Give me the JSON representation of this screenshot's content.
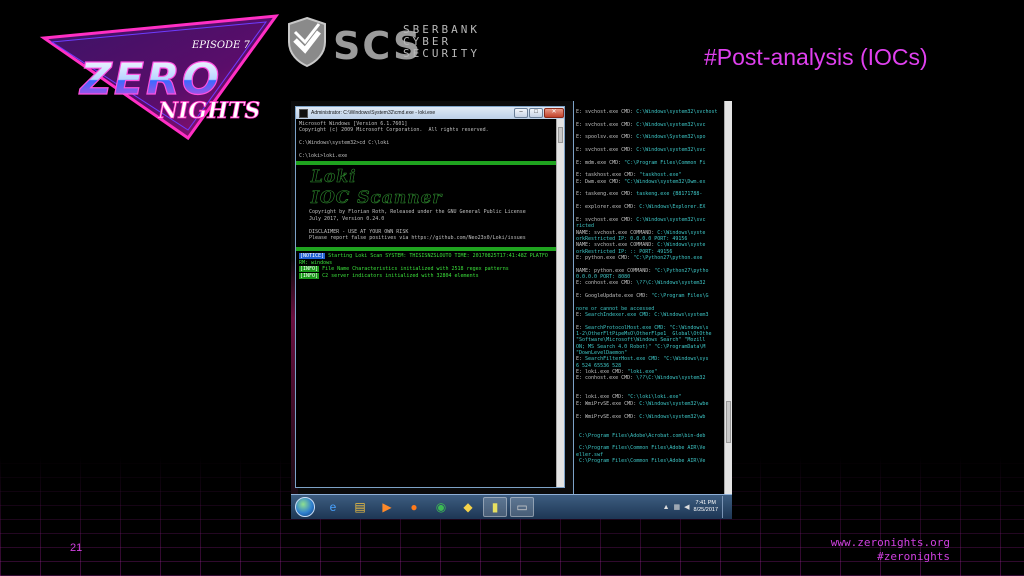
{
  "slide": {
    "title": "#Post-analysis (IOCs)",
    "page_number": "21",
    "website": "www.zeronights.org",
    "hashtag": "#zeronights",
    "accent_color": "#e040ef"
  },
  "logos": {
    "zeronights": {
      "episode": "EPISODE 7",
      "word1": "ZERO",
      "word2": "NIGHTS"
    },
    "scs": {
      "letters": "SCS",
      "line1": "SBERBANK",
      "line2": "CYBER",
      "line3": "SECURITY"
    }
  },
  "cmd1": {
    "title": "Administrator: C:\\Windows\\System32\\cmd.exe - loki.exe",
    "buttons": {
      "minimize": "–",
      "maximize": "□",
      "close": "✕"
    },
    "lines": {
      "l1": "Microsoft Windows [Version 6.1.7601]",
      "l2": "Copyright (c) 2009 Microsoft Corporation.  All rights reserved.",
      "l3": "C:\\Windows\\system32>cd C:\\loki",
      "l4": "C:\\loki>loki.exe",
      "big1": "Loki",
      "big2": "IOC Scanner",
      "l5": "Copyright by Florian Roth, Released under the GNU General Public License",
      "l6": "July 2017, Version 0.24.0",
      "l7": "DISCLAIMER - USE AT YOUR OWN RISK",
      "l8": "Please report false positives via https://github.com/Neo23x0/Loki/issues",
      "notice_label": "[NOTICE]",
      "notice_text": " Starting Loki Scan SYSTEM: THISISNZSLOUTO TIME: 20170825T17:41:48Z PLATFO",
      "notice_cont": "RM: windows",
      "info1_label": "[INFO]",
      "info1_text": " File Name Characteristics initialized with 2518 regex patterns",
      "info2_label": "[INFO]",
      "info2_text": " C2 server indicators initialized with 32804 elements"
    }
  },
  "cmd2": {
    "lines": [
      {
        "k": "E: svchost.exe CMD: ",
        "v": "C:\\Windows\\system32\\svchost"
      },
      {
        "k": "",
        "v": ""
      },
      {
        "k": "E: svchost.exe CMD: ",
        "v": "C:\\Windows\\system32\\svc"
      },
      {
        "k": "",
        "v": ""
      },
      {
        "k": "E: spoolsv.exe CMD: ",
        "v": "C:\\Windows\\System32\\spo"
      },
      {
        "k": "",
        "v": ""
      },
      {
        "k": "E: svchost.exe CMD: ",
        "v": "C:\\Windows\\system32\\svc"
      },
      {
        "k": "",
        "v": ""
      },
      {
        "k": "E: mdm.exe CMD: ",
        "v": "\"C:\\Program Files\\Common Fi"
      },
      {
        "k": "",
        "v": ""
      },
      {
        "k": "E: taskhost.exe CMD: ",
        "v": "\"taskhost.exe\""
      },
      {
        "k": "E: Dwm.exe CMD: ",
        "v": "\"C:\\Windows\\system32\\Dwm.ex"
      },
      {
        "k": "",
        "v": ""
      },
      {
        "k": "E: taskeng.exe CMD: ",
        "v": "taskeng.exe {B8171788-"
      },
      {
        "k": "",
        "v": ""
      },
      {
        "k": "E: explorer.exe CMD: ",
        "v": "C:\\Windows\\Explorer.EX"
      },
      {
        "k": "",
        "v": ""
      },
      {
        "k": "E: svchost.exe CMD: ",
        "v": "C:\\Windows\\system32\\svc"
      },
      {
        "k": "",
        "v": "ricted"
      },
      {
        "k": "NAME: svchost.exe COMMAND: ",
        "v": "C:\\Windows\\syste"
      },
      {
        "k": "",
        "v": "orkRestricted IP: 0.0.0.0 PORT: 49156"
      },
      {
        "k": "NAME: svchost.exe COMMAND: ",
        "v": "C:\\Windows\\syste"
      },
      {
        "k": "",
        "v": "orkRestricted IP: :: PORT: 49156"
      },
      {
        "k": "E: python.exe CMD: ",
        "v": "\"C:\\Python27\\python.exe"
      },
      {
        "k": "",
        "v": ""
      },
      {
        "k": "NAME: python.exe COMMAND: ",
        "v": "\"C:\\Python27\\pytho"
      },
      {
        "k": "",
        "v": "0.0.0.0 PORT: 8080"
      },
      {
        "k": "E: conhost.exe CMD: ",
        "v": "\\??\\C:\\Windows\\system32"
      },
      {
        "k": "",
        "v": ""
      },
      {
        "k": "E: GoogleUpdate.exe CMD: ",
        "v": "\"C:\\Program Files\\G"
      },
      {
        "k": "",
        "v": ""
      },
      {
        "k": "",
        "v": "nore or cannot be accessed"
      },
      {
        "k": "E: ",
        "v": "SearchIndexer.exe CMD: C:\\Windows\\system3"
      },
      {
        "k": "",
        "v": ""
      },
      {
        "k": "E: ",
        "v": "SearchProtocolHost.exe CMD: \"C:\\Windows\\s"
      },
      {
        "k": "",
        "v": "1-2\\OtherFltPipeMsO\\OtherFlpe1_ Global\\OtOthe"
      },
      {
        "k": "",
        "v": "\"Software\\Microsoft\\Windows Search\" \"Mozill"
      },
      {
        "k": "",
        "v": "ON; MS Search 4.0 Robot)\" \"C:\\ProgramData\\M"
      },
      {
        "k": "",
        "v": "\"DownLevelDaemon\""
      },
      {
        "k": "E: ",
        "v": "SearchFilterHost.exe CMD: \"C:\\Windows\\sys"
      },
      {
        "k": "",
        "v": "6 524 65536 528"
      },
      {
        "k": "E: loki.exe CMD: ",
        "v": "\"loki.exe\""
      },
      {
        "k": "E: conhost.exe CMD: ",
        "v": "\\??\\C:\\Windows\\system32"
      },
      {
        "k": "",
        "v": ""
      },
      {
        "k": "",
        "v": ""
      },
      {
        "k": "E: loki.exe CMD: ",
        "v": "\"C:\\loki\\loki.exe\""
      },
      {
        "k": "E: WmiPrvSE.exe CMD: ",
        "v": "C:\\Windows\\system32\\wbe"
      },
      {
        "k": "",
        "v": ""
      },
      {
        "k": "E: WmiPrvSE.exe CMD: ",
        "v": "C:\\Windows\\system32\\wb"
      },
      {
        "k": "",
        "v": ""
      },
      {
        "k": "",
        "v": ""
      },
      {
        "k": "",
        "v": " C:\\Program Files\\Adobe\\Acrobat.com\\bin-deb"
      },
      {
        "k": "",
        "v": ""
      },
      {
        "k": "",
        "v": " C:\\Program Files\\Common Files\\Adobe AIR\\Ve"
      },
      {
        "k": "",
        "v": "eller.swf"
      },
      {
        "k": "",
        "v": " C:\\Program Files\\Common Files\\Adobe AIR\\Ve"
      }
    ]
  },
  "taskbar": {
    "items": [
      {
        "name": "internet-explorer-icon",
        "glyph": "e",
        "color": "#4aa3ff"
      },
      {
        "name": "windows-explorer-icon",
        "glyph": "▤",
        "color": "#f0c040"
      },
      {
        "name": "media-player-icon",
        "glyph": "▶",
        "color": "#ff8a2a"
      },
      {
        "name": "firefox-icon",
        "glyph": "●",
        "color": "#ff7a1a"
      },
      {
        "name": "chrome-icon",
        "glyph": "◉",
        "color": "#3cba54"
      },
      {
        "name": "python-icon",
        "glyph": "◆",
        "color": "#f5d34a"
      },
      {
        "name": "notepad-icon",
        "glyph": "▮",
        "color": "#e8e060"
      },
      {
        "name": "cmd-icon",
        "glyph": "▭",
        "color": "#cfcfcf"
      }
    ],
    "time": "7:41 PM",
    "date": "8/25/2017"
  }
}
